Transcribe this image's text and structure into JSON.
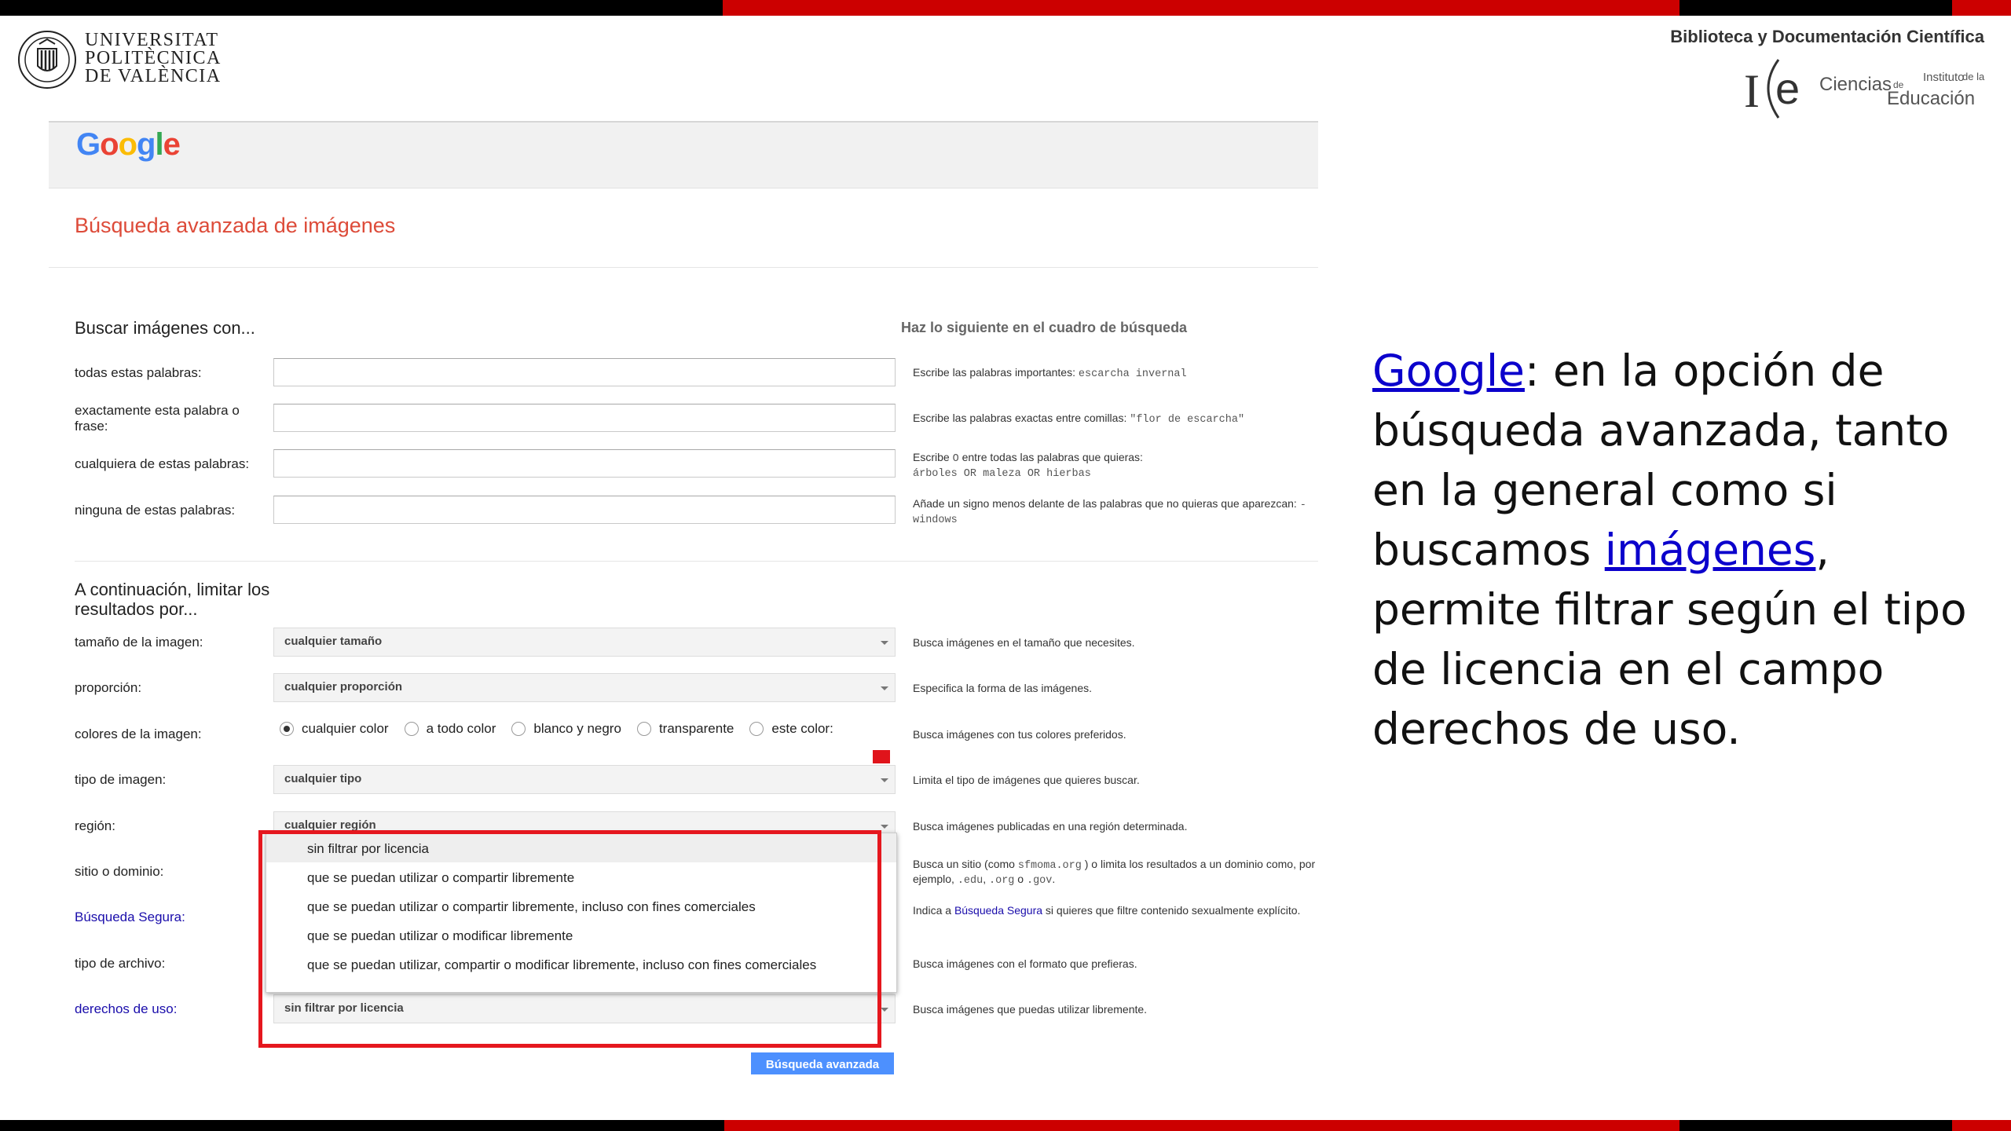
{
  "colors": {
    "stripe_black": "#000000",
    "stripe_red": "#cc0000",
    "google_title": "#dd4b39",
    "link_blue": "#1a0dab",
    "button_blue": "#4d90fe",
    "highlight_red": "#e5171e"
  },
  "upv": {
    "line1": "UNIVERSITAT",
    "line2": "POLITÈCNICA",
    "line3": "DE VALÈNCIA"
  },
  "biblioteca": "Biblioteca y Documentación Científica",
  "ice": {
    "ciencias": "Ciencias",
    "instituto": "Instituto",
    "de": "de",
    "dela": "de la",
    "educacion": "Educación"
  },
  "google": {
    "logo": "Google",
    "page_title": "Búsqueda avanzada de imágenes",
    "section1_title": "Buscar imágenes con...",
    "section1_right": "Haz lo siguiente en el cuadro de búsqueda",
    "fields": [
      {
        "label": "todas estas palabras:",
        "hint": "Escribe las palabras importantes:",
        "example": "escarcha invernal"
      },
      {
        "label": "exactamente esta palabra o frase:",
        "hint": "Escribe las palabras exactas entre comillas:",
        "example": "\"flor de escarcha\""
      },
      {
        "label": "cualquiera de estas palabras:",
        "hint": "Escribe",
        "hint_code": "O",
        "hint_tail": "entre todas las palabras que quieras:",
        "example": "árboles OR maleza OR hierbas"
      },
      {
        "label": "ninguna de estas palabras:",
        "hint": "Añade un signo menos delante de las palabras que no quieras que aparezcan:",
        "example": "-windows"
      }
    ],
    "section2_title": "A continuación, limitar los resultados por...",
    "filters": {
      "size": {
        "label": "tamaño de la imagen:",
        "value": "cualquier tamaño",
        "hint": "Busca imágenes en el tamaño que necesites."
      },
      "aspect": {
        "label": "proporción:",
        "value": "cualquier proporción",
        "hint": "Especifica la forma de las imágenes."
      },
      "colors": {
        "label": "colores de la imagen:",
        "options": [
          "cualquier color",
          "a todo color",
          "blanco y negro",
          "transparente",
          "este color:"
        ],
        "selected": "cualquier color",
        "hint": "Busca imágenes con tus colores preferidos.",
        "swatch_color": "#e0141b"
      },
      "type": {
        "label": "tipo de imagen:",
        "value": "cualquier tipo",
        "hint": "Limita el tipo de imágenes que quieres buscar."
      },
      "region": {
        "label": "región:",
        "value": "cualquier región",
        "hint": "Busca imágenes publicadas en una región determinada."
      },
      "site": {
        "label": "sitio o dominio:",
        "hint_a": "Busca un sitio (como",
        "hint_code1": "sfmoma.org",
        "hint_b": ") o limita los resultados a un dominio como, por ejemplo,",
        "hint_code2": ".edu",
        "hint_code3": ".org",
        "hint_c": "o",
        "hint_code4": ".gov",
        "hint_d": "."
      },
      "safe": {
        "label": "Búsqueda Segura:",
        "hint_a": "Indica a",
        "hint_link": "Búsqueda Segura",
        "hint_b": "si quieres que filtre contenido sexualmente explícito."
      },
      "filetype": {
        "label": "tipo de archivo:",
        "hint": "Busca imágenes con el formato que prefieras."
      },
      "rights": {
        "label": "derechos de uso:",
        "value": "sin filtrar por licencia",
        "hint": "Busca imágenes que puedas utilizar libremente."
      }
    },
    "rights_options": [
      "sin filtrar por licencia",
      "que se puedan utilizar o compartir libremente",
      "que se puedan utilizar o compartir libremente, incluso con fines comerciales",
      "que se puedan utilizar o modificar libremente",
      "que se puedan utilizar, compartir o modificar libremente, incluso con fines comerciales"
    ],
    "submit": "Búsqueda avanzada"
  },
  "right_text": {
    "link1": "Google",
    "part1": ": en la opción de búsqueda avanzada, tanto en la general como si buscamos ",
    "link2": "imágenes",
    "part2": ", permite filtrar según el tipo de licencia en el campo derechos de uso."
  }
}
